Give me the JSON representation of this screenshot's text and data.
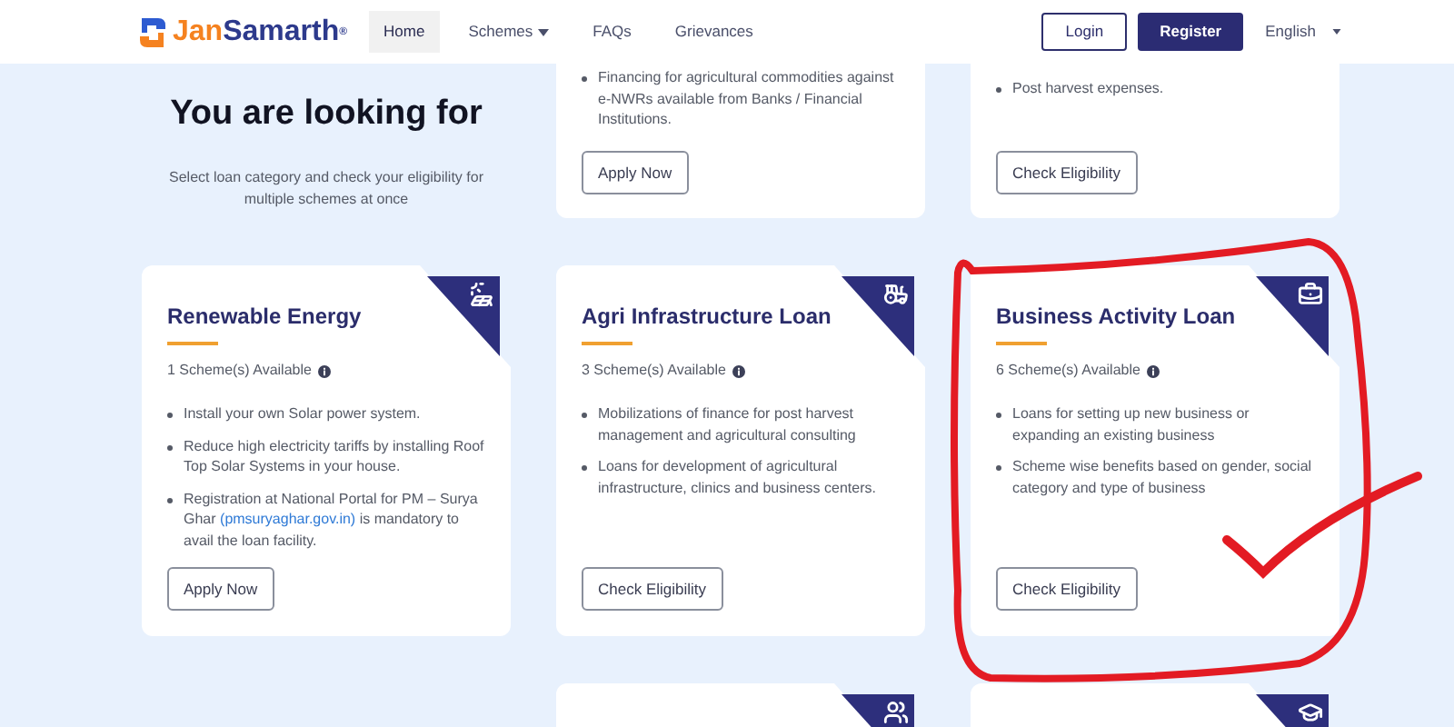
{
  "header": {
    "brand": {
      "first": "Jan",
      "second": "Samarth",
      "mark": "®"
    },
    "nav": [
      {
        "label": "Home",
        "selected": true,
        "dropdown": false
      },
      {
        "label": "Schemes",
        "selected": false,
        "dropdown": true
      },
      {
        "label": "FAQs",
        "selected": false,
        "dropdown": false
      },
      {
        "label": "Grievances",
        "selected": false,
        "dropdown": false
      }
    ],
    "login": "Login",
    "register": "Register",
    "language": "English"
  },
  "intro": {
    "title": "You are looking for",
    "subtitle": "Select loan category and check your eligibility for multiple schemes at once"
  },
  "top_cards": [
    {
      "bullets": [
        {
          "text": "Financing for agricultural commodities against e-NWRs available from Banks / Financial Institutions."
        }
      ],
      "button": "Apply Now"
    },
    {
      "bullets": [
        {
          "text": "Post harvest expenses."
        }
      ],
      "button": "Check Eligibility"
    }
  ],
  "cards": [
    {
      "title": "Renewable Energy",
      "schemes": "1 Scheme(s) Available",
      "bullets": [
        {
          "text": "Install your own Solar power system."
        },
        {
          "text": "Reduce high electricity tariffs by installing Roof Top Solar Systems in your house."
        },
        {
          "text": "Registration at National Portal for PM – Surya Ghar",
          "link": "(pmsuryaghar.gov.in)",
          "after": "is mandatory to avail the loan facility."
        }
      ],
      "button": "Apply Now"
    },
    {
      "title": "Agri Infrastructure Loan",
      "schemes": "3 Scheme(s) Available",
      "bullets": [
        {
          "text": "Mobilizations of finance for post harvest management and agricultural consulting"
        },
        {
          "text": "Loans for development of agricultural infrastructure, clinics and business centers."
        }
      ],
      "button": "Check Eligibility"
    },
    {
      "title": "Business Activity Loan",
      "schemes": "6 Scheme(s) Available",
      "bullets": [
        {
          "text": "Loans for setting up new business or expanding an existing business"
        },
        {
          "text": "Scheme wise benefits based on gender, social category and type of business"
        }
      ],
      "button": "Check Eligibility"
    }
  ]
}
